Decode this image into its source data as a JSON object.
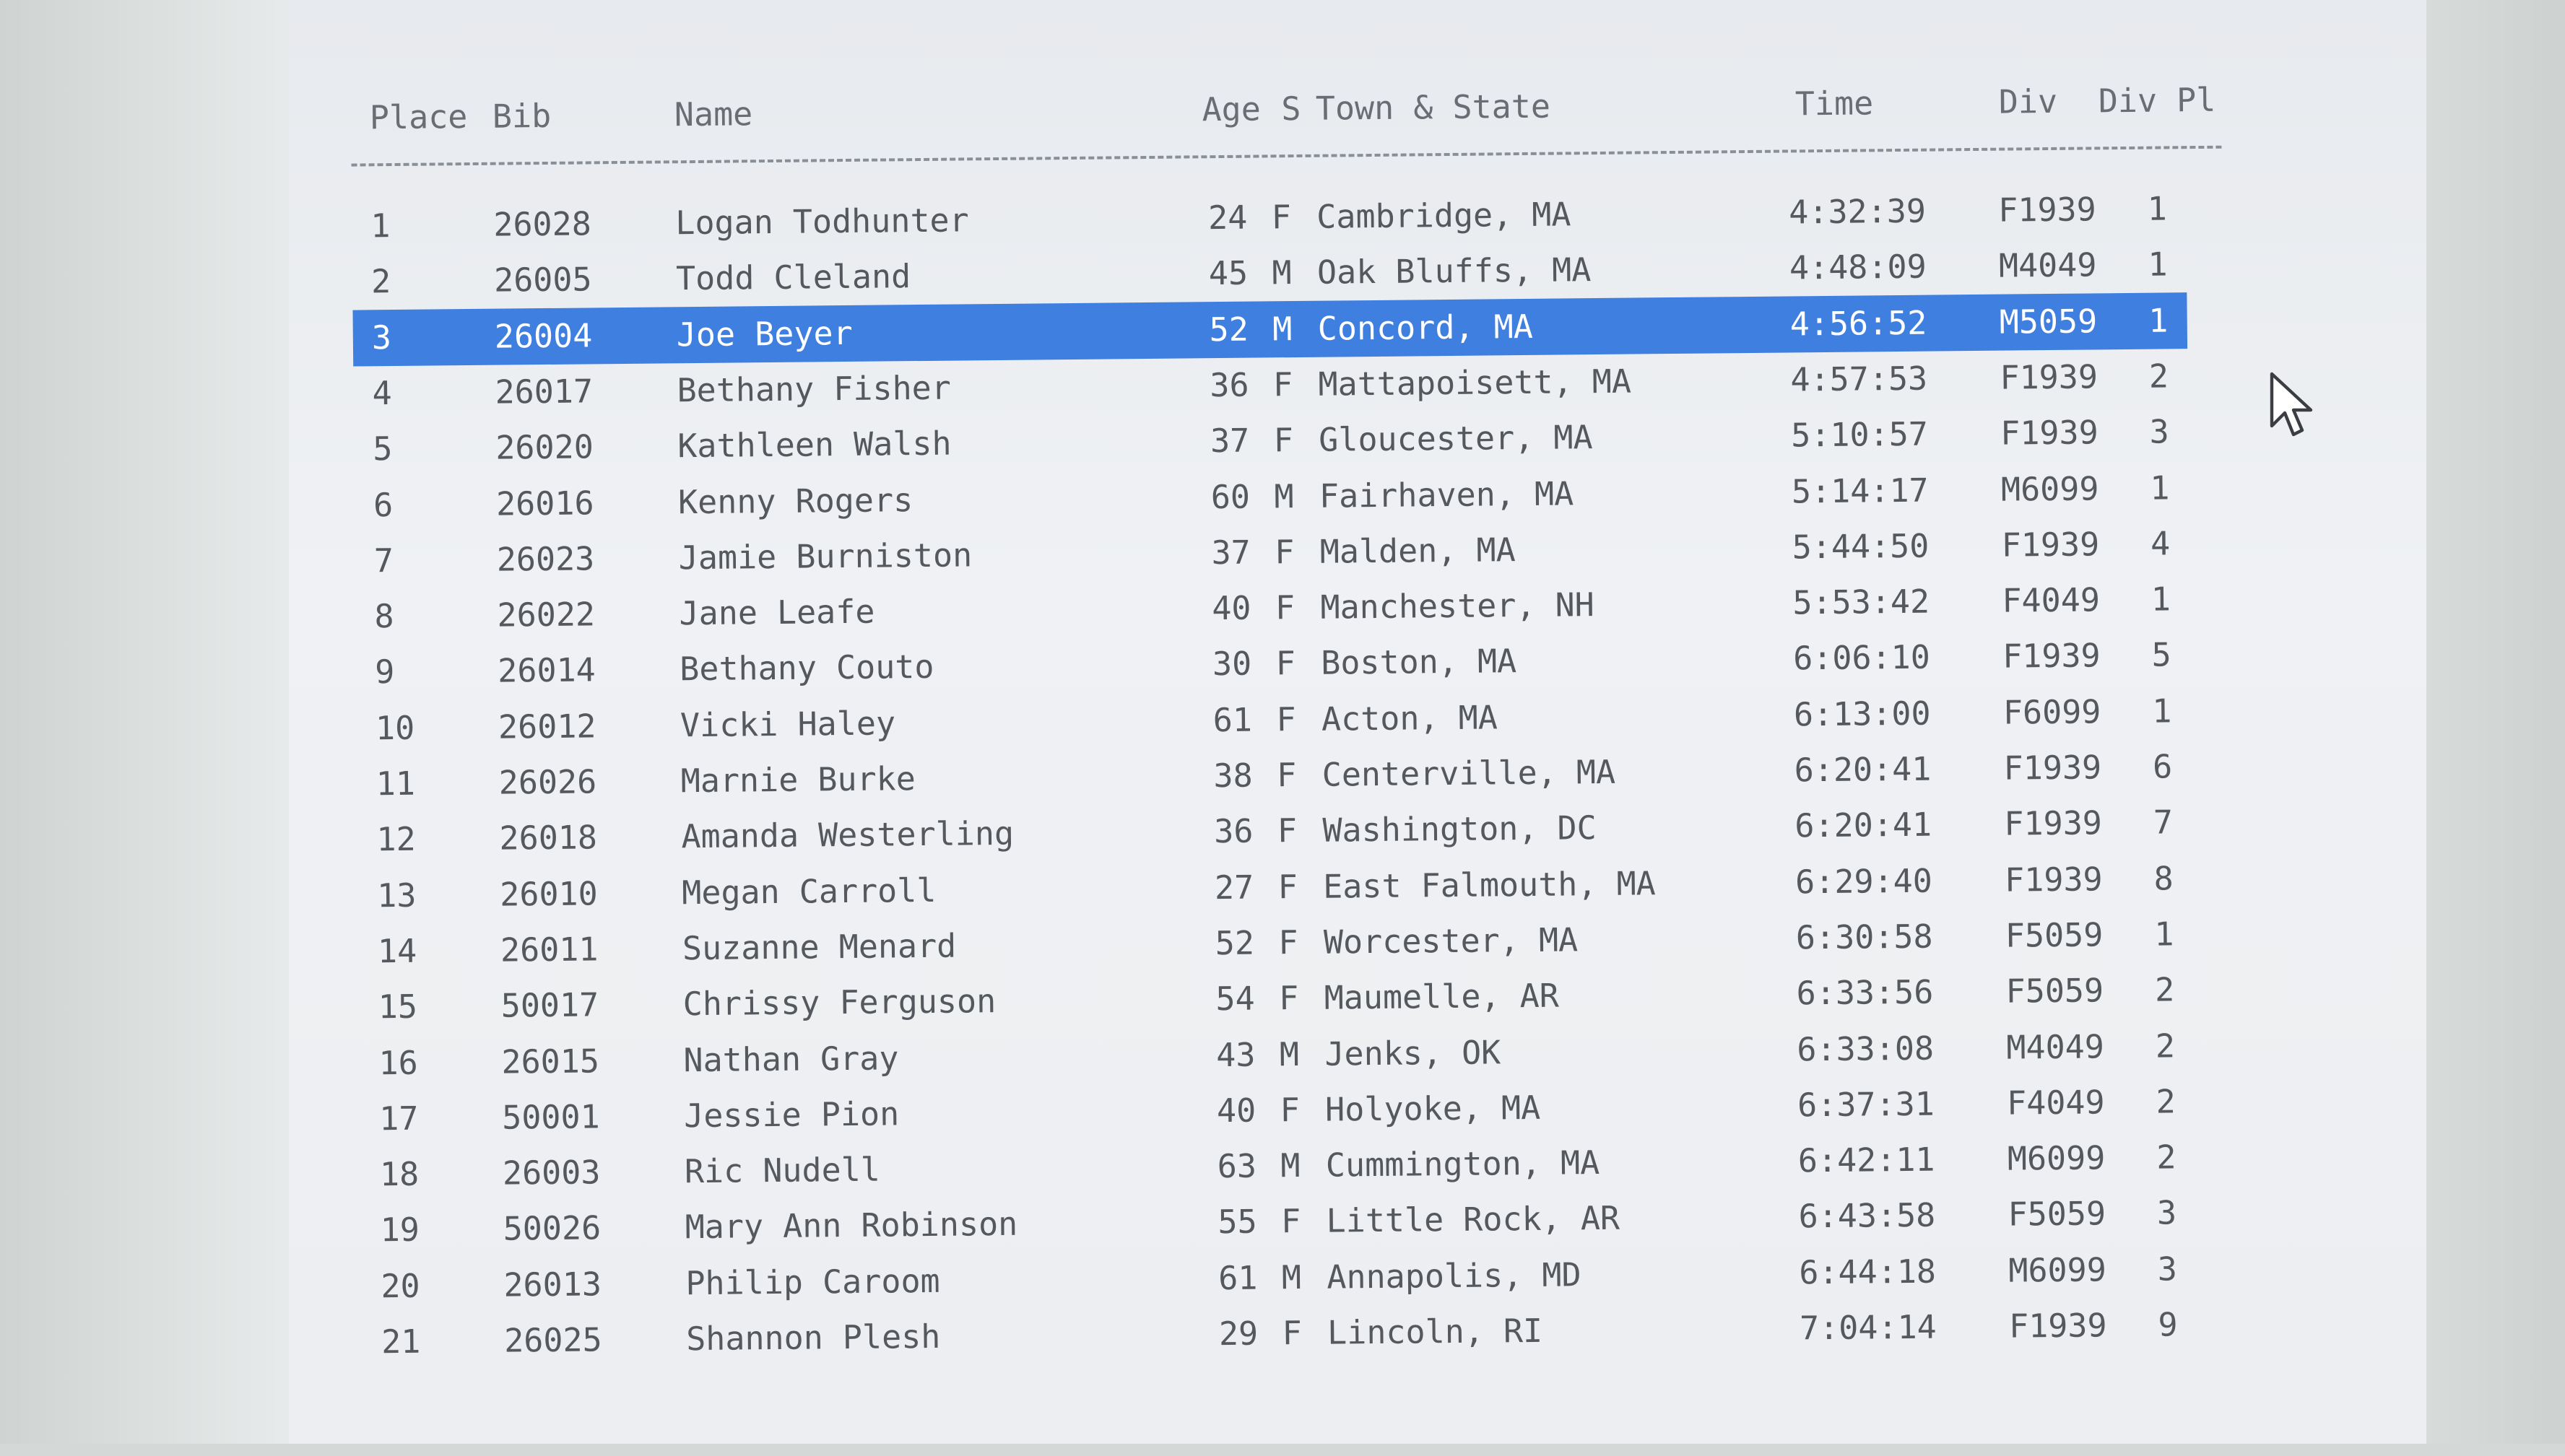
{
  "columns": {
    "place": "Place",
    "bib": "Bib",
    "name": "Name",
    "age": "Age",
    "sex": "S",
    "town": "Town & State",
    "time": "Time",
    "div": "Div",
    "div_place": "Div Pl"
  },
  "selected_place": "3",
  "rows": [
    {
      "place": "1",
      "bib": "26028",
      "name": "Logan Todhunter",
      "age": "24",
      "sex": "F",
      "town": "Cambridge, MA",
      "time": "4:32:39",
      "div": "F1939",
      "div_place": "1"
    },
    {
      "place": "2",
      "bib": "26005",
      "name": "Todd Cleland",
      "age": "45",
      "sex": "M",
      "town": "Oak Bluffs, MA",
      "time": "4:48:09",
      "div": "M4049",
      "div_place": "1"
    },
    {
      "place": "3",
      "bib": "26004",
      "name": "Joe Beyer",
      "age": "52",
      "sex": "M",
      "town": "Concord, MA",
      "time": "4:56:52",
      "div": "M5059",
      "div_place": "1"
    },
    {
      "place": "4",
      "bib": "26017",
      "name": "Bethany Fisher",
      "age": "36",
      "sex": "F",
      "town": "Mattapoisett, MA",
      "time": "4:57:53",
      "div": "F1939",
      "div_place": "2"
    },
    {
      "place": "5",
      "bib": "26020",
      "name": "Kathleen Walsh",
      "age": "37",
      "sex": "F",
      "town": "Gloucester, MA",
      "time": "5:10:57",
      "div": "F1939",
      "div_place": "3"
    },
    {
      "place": "6",
      "bib": "26016",
      "name": "Kenny Rogers",
      "age": "60",
      "sex": "M",
      "town": "Fairhaven, MA",
      "time": "5:14:17",
      "div": "M6099",
      "div_place": "1"
    },
    {
      "place": "7",
      "bib": "26023",
      "name": "Jamie Burniston",
      "age": "37",
      "sex": "F",
      "town": "Malden, MA",
      "time": "5:44:50",
      "div": "F1939",
      "div_place": "4"
    },
    {
      "place": "8",
      "bib": "26022",
      "name": "Jane Leafe",
      "age": "40",
      "sex": "F",
      "town": "Manchester, NH",
      "time": "5:53:42",
      "div": "F4049",
      "div_place": "1"
    },
    {
      "place": "9",
      "bib": "26014",
      "name": "Bethany Couto",
      "age": "30",
      "sex": "F",
      "town": "Boston, MA",
      "time": "6:06:10",
      "div": "F1939",
      "div_place": "5"
    },
    {
      "place": "10",
      "bib": "26012",
      "name": "Vicki Haley",
      "age": "61",
      "sex": "F",
      "town": "Acton, MA",
      "time": "6:13:00",
      "div": "F6099",
      "div_place": "1"
    },
    {
      "place": "11",
      "bib": "26026",
      "name": "Marnie Burke",
      "age": "38",
      "sex": "F",
      "town": "Centerville, MA",
      "time": "6:20:41",
      "div": "F1939",
      "div_place": "6"
    },
    {
      "place": "12",
      "bib": "26018",
      "name": "Amanda Westerling",
      "age": "36",
      "sex": "F",
      "town": "Washington, DC",
      "time": "6:20:41",
      "div": "F1939",
      "div_place": "7"
    },
    {
      "place": "13",
      "bib": "26010",
      "name": "Megan Carroll",
      "age": "27",
      "sex": "F",
      "town": "East Falmouth, MA",
      "time": "6:29:40",
      "div": "F1939",
      "div_place": "8"
    },
    {
      "place": "14",
      "bib": "26011",
      "name": "Suzanne Menard",
      "age": "52",
      "sex": "F",
      "town": "Worcester, MA",
      "time": "6:30:58",
      "div": "F5059",
      "div_place": "1"
    },
    {
      "place": "15",
      "bib": "50017",
      "name": "Chrissy Ferguson",
      "age": "54",
      "sex": "F",
      "town": "Maumelle, AR",
      "time": "6:33:56",
      "div": "F5059",
      "div_place": "2"
    },
    {
      "place": "16",
      "bib": "26015",
      "name": "Nathan Gray",
      "age": "43",
      "sex": "M",
      "town": "Jenks, OK",
      "time": "6:33:08",
      "div": "M4049",
      "div_place": "2"
    },
    {
      "place": "17",
      "bib": "50001",
      "name": "Jessie Pion",
      "age": "40",
      "sex": "F",
      "town": "Holyoke, MA",
      "time": "6:37:31",
      "div": "F4049",
      "div_place": "2"
    },
    {
      "place": "18",
      "bib": "26003",
      "name": "Ric Nudell",
      "age": "63",
      "sex": "M",
      "town": "Cummington, MA",
      "time": "6:42:11",
      "div": "M6099",
      "div_place": "2"
    },
    {
      "place": "19",
      "bib": "50026",
      "name": "Mary Ann Robinson",
      "age": "55",
      "sex": "F",
      "town": "Little Rock, AR",
      "time": "6:43:58",
      "div": "F5059",
      "div_place": "3"
    },
    {
      "place": "20",
      "bib": "26013",
      "name": "Philip Caroom",
      "age": "61",
      "sex": "M",
      "town": "Annapolis, MD",
      "time": "6:44:18",
      "div": "M6099",
      "div_place": "3"
    },
    {
      "place": "21",
      "bib": "26025",
      "name": "Shannon Plesh",
      "age": "29",
      "sex": "F",
      "town": "Lincoln, RI",
      "time": "7:04:14",
      "div": "F1939",
      "div_place": "9"
    }
  ],
  "colors": {
    "selection": "#3f7fe0",
    "text": "#55595e",
    "background": "#eceef1"
  },
  "cursor_icon": "arrow-pointer-icon"
}
